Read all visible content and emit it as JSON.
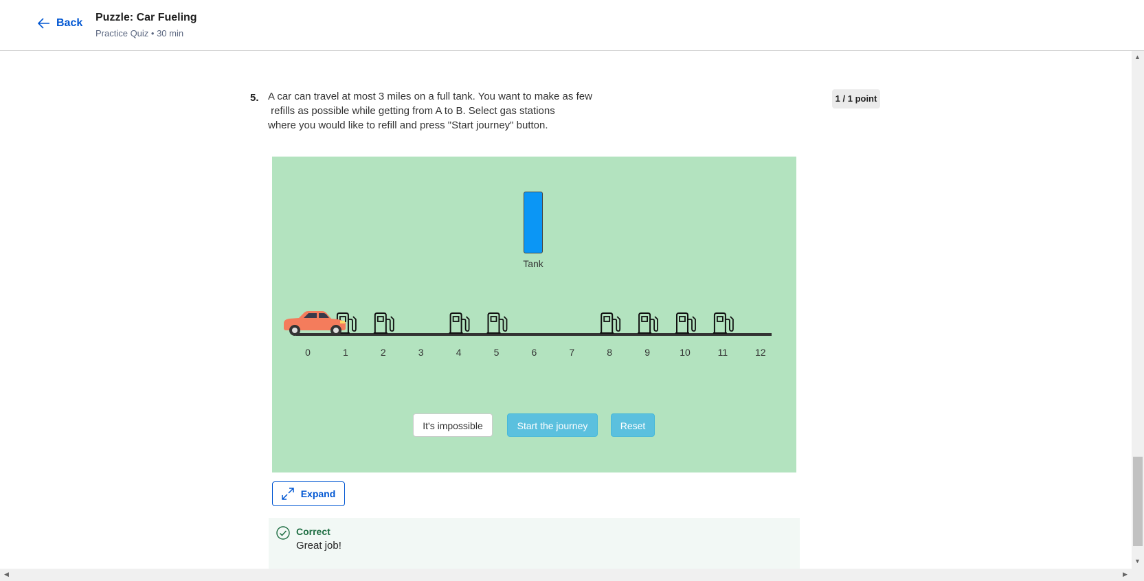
{
  "header": {
    "back_label": "Back",
    "title": "Puzzle: Car Fueling",
    "subtitle": "Practice Quiz • 30 min"
  },
  "question": {
    "number": "5.",
    "lines": [
      "A car can travel at most 3 miles on a full tank. You want to make as few",
      " refills as possible while getting from A to B. Select gas stations",
      "where you would like to refill and press \"Start journey\" button."
    ],
    "points": "1 / 1 point"
  },
  "puzzle": {
    "tank_label": "Tank",
    "tank_level": 1.0,
    "axis_labels": [
      "0",
      "1",
      "2",
      "3",
      "4",
      "5",
      "6",
      "7",
      "8",
      "9",
      "10",
      "11",
      "12"
    ],
    "stations_at": [
      1,
      2,
      4,
      5,
      8,
      9,
      10,
      11
    ],
    "car_position": 0,
    "buttons": {
      "impossible": "It's impossible",
      "start": "Start the journey",
      "reset": "Reset"
    },
    "colors": {
      "background": "#b3e3bf",
      "tank": "#0b96f5",
      "car": "#f47c5c",
      "button": "#5bc0de"
    }
  },
  "expand_label": "Expand",
  "feedback": {
    "title": "Correct",
    "message": "Great job!"
  }
}
